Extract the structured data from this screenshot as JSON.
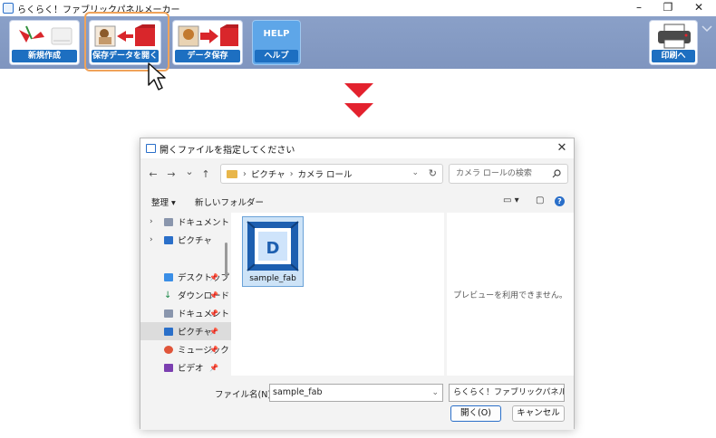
{
  "window": {
    "title": "らくらく！ファブリックパネルメーカー",
    "controls": {
      "minimize": "–",
      "maximize": "❐",
      "close": "✕"
    }
  },
  "toolbar": {
    "buttons": [
      {
        "label": "新規作成",
        "icon": "new-document-icon"
      },
      {
        "label": "保存データを開く",
        "icon": "open-saved-data-icon"
      },
      {
        "label": "データ保存",
        "icon": "save-data-icon"
      },
      {
        "label": "ヘルプ",
        "top_text": "HELP",
        "icon": "help-icon"
      },
      {
        "label": "印刷へ",
        "icon": "printer-icon"
      }
    ]
  },
  "dialog": {
    "title": "開くファイルを指定してください",
    "close_glyph": "✕",
    "nav": {
      "back": "←",
      "forward": "→",
      "recent": "⌄",
      "up": "↑"
    },
    "breadcrumb": [
      "ピクチャ",
      "カメラ ロール"
    ],
    "search_placeholder": "カメラ ロールの検索",
    "commands": {
      "organize": "整理 ▾",
      "new_folder": "新しいフォルダー"
    },
    "sidebar": [
      {
        "label": "ドキュメント",
        "chevron": "›",
        "icon": "documents-icon",
        "pinned": false
      },
      {
        "label": "ピクチャ",
        "chevron": "›",
        "icon": "pictures-icon",
        "pinned": false
      },
      {
        "label": "デスクトップ",
        "chevron": "",
        "icon": "desktop-icon",
        "pinned": true
      },
      {
        "label": "ダウンロード",
        "chevron": "",
        "icon": "downloads-icon",
        "pinned": true
      },
      {
        "label": "ドキュメント",
        "chevron": "",
        "icon": "documents-icon",
        "pinned": true
      },
      {
        "label": "ピクチャ",
        "chevron": "",
        "icon": "pictures-icon",
        "pinned": true,
        "selected": true
      },
      {
        "label": "ミュージック",
        "chevron": "",
        "icon": "music-icon",
        "pinned": true
      },
      {
        "label": "ビデオ",
        "chevron": "",
        "icon": "videos-icon",
        "pinned": true
      }
    ],
    "files": [
      {
        "name": "sample_fab",
        "icon": "fabric-panel-file-icon",
        "letter": "D"
      }
    ],
    "preview_text": "プレビューを利用できません。",
    "filename_label": "ファイル名(N):",
    "filename_value": "sample_fab",
    "filetype_value": "らくらく！ファブリックパネルメ",
    "open_button": "開く(O)",
    "cancel_button": "キャンセル"
  },
  "colors": {
    "toolbar_bg": "#8aa0c8",
    "button_label_bg": "#1d6fc1",
    "highlight": "#f0a35a",
    "arrow_red": "#e3222e"
  }
}
